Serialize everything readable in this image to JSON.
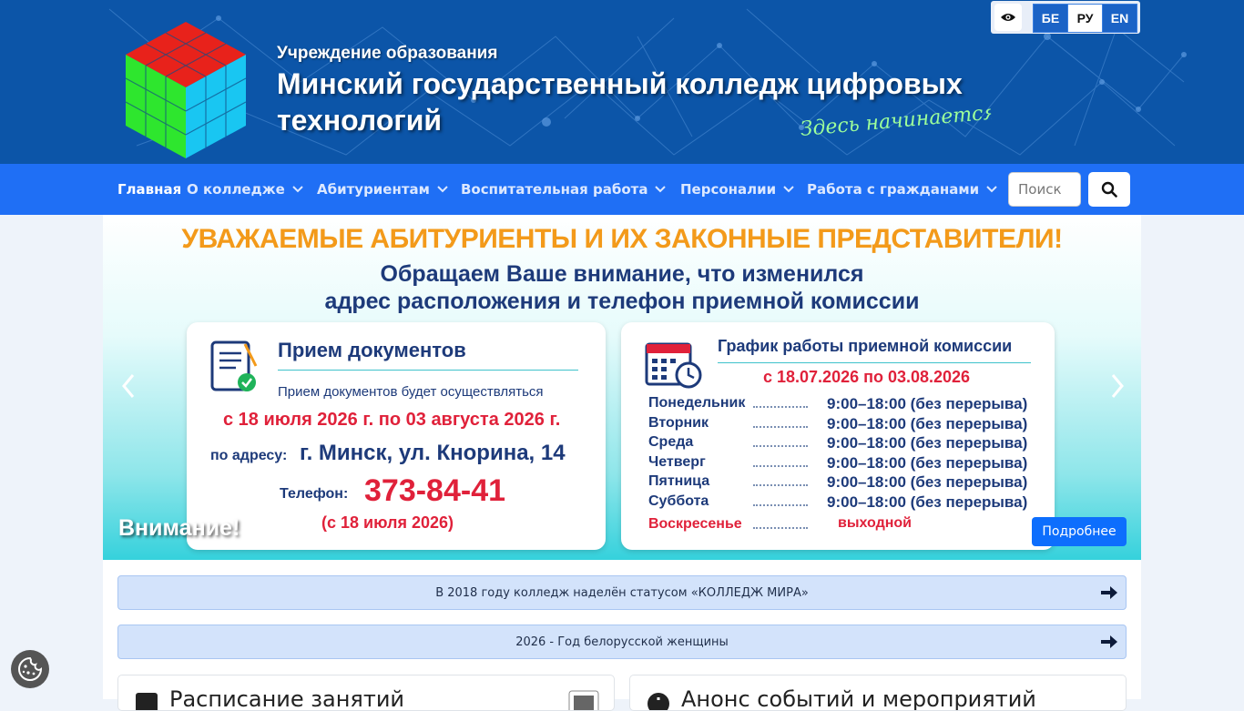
{
  "header": {
    "org_subtitle": "Учреждение образования",
    "org_title": "Минский государственный колледж цифровых технологий",
    "slogan": "Здесь начинается тв",
    "languages": [
      {
        "code": "БЕ",
        "active": false
      },
      {
        "code": "РУ",
        "active": true
      },
      {
        "code": "EN",
        "active": false
      }
    ],
    "accessibility_icon": "eye-icon",
    "brand_color": "#0c55a8"
  },
  "nav": {
    "items": [
      "Главная",
      "О колледже",
      "Абитуриентам",
      "Воспитательная работа",
      "Персоналии",
      "Работа с гражданами"
    ],
    "search_placeholder": "Поиск",
    "search_icon": "search-icon",
    "navbar_color": "#1f6ff5"
  },
  "banner": {
    "headline": "УВАЖАЕМЫЕ АБИТУРИЕНТЫ И ИХ ЗАКОННЫЕ ПРЕДСТАВИТЕЛИ!",
    "subline1": "Обращаем Ваше внимание, что изменился",
    "subline2": "адрес расположения и телефон приемной комиссии",
    "docs": {
      "title": "Прием документов",
      "line1": "Прием документов будет осуществляться",
      "dates": "с 18 июля 2026 г. по 03 августа 2026 г.",
      "address_label": "по адресу:",
      "address": "г. Минск, ул. Кнорина, 14",
      "phone_label": "Телефон:",
      "phone": "373-84-41",
      "phone_note": "(с 18 июля 2026)"
    },
    "schedule": {
      "title": "График работы приемной комиссии",
      "range": "с 18.07.2026 по 03.08.2026",
      "days": [
        {
          "day": "Понедельник",
          "time": "9:00–18:00 (без перерыва)"
        },
        {
          "day": "Вторник",
          "time": "9:00–18:00 (без перерыва)"
        },
        {
          "day": "Среда",
          "time": "9:00–18:00 (без перерыва)"
        },
        {
          "day": "Четверг",
          "time": "9:00–18:00 (без перерыва)"
        },
        {
          "day": "Пятница",
          "time": "9:00–18:00 (без перерыва)"
        },
        {
          "day": "Суббота",
          "time": "9:00–18:00 (без перерыва)"
        },
        {
          "day": "Воскресенье",
          "time": "выходной"
        }
      ]
    },
    "caption": "Внимание!",
    "more_label": "Подробнее"
  },
  "news": [
    {
      "text": "В 2018 году колледж наделён статусом «КОЛЛЕДЖ МИРА»"
    },
    {
      "text": "2026 - Год белорусской женщины"
    }
  ],
  "panels": [
    {
      "title": "Расписание занятий",
      "icon": "calendar-icon"
    },
    {
      "title": "Анонс событий и мероприятий",
      "icon": "info-icon"
    }
  ],
  "cookie_icon": "cookie-icon"
}
